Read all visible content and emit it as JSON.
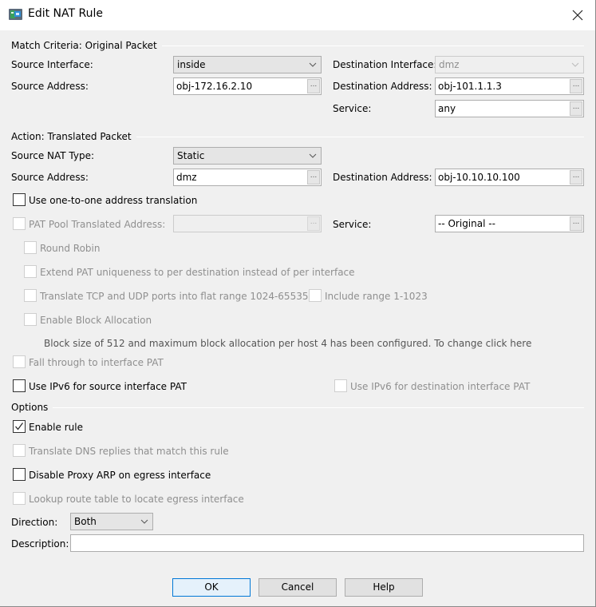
{
  "window": {
    "title": "Edit NAT Rule",
    "icon": "asdm-app-icon",
    "close_icon": "close-icon"
  },
  "match_criteria": {
    "section_title": "Match Criteria: Original Packet",
    "source_interface": {
      "label": "Source Interface:",
      "value": "inside"
    },
    "destination_interface": {
      "label": "Destination Interface:",
      "value": "dmz",
      "disabled": true
    },
    "source_address": {
      "label": "Source Address:",
      "value": "obj-172.16.2.10"
    },
    "destination_address": {
      "label": "Destination Address:",
      "value": "obj-101.1.1.3"
    },
    "service": {
      "label": "Service:",
      "value": "any"
    }
  },
  "action": {
    "section_title": "Action: Translated Packet",
    "source_nat_type": {
      "label": "Source NAT Type:",
      "value": "Static"
    },
    "source_address": {
      "label": "Source Address:",
      "value": "dmz"
    },
    "destination_address": {
      "label": "Destination Address:",
      "value": "obj-10.10.10.100"
    },
    "one_to_one": {
      "label": "Use one-to-one address translation",
      "checked": false,
      "disabled": false
    },
    "pat_pool": {
      "label": "PAT Pool Translated Address:",
      "value": "",
      "checked": false,
      "disabled": true
    },
    "service": {
      "label": "Service:",
      "value": "-- Original --"
    },
    "round_robin": {
      "label": "Round Robin",
      "checked": false,
      "disabled": true
    },
    "extend_pat": {
      "label": "Extend PAT uniqueness to per destination instead of per interface",
      "checked": false,
      "disabled": true
    },
    "flat_range": {
      "label": "Translate TCP and UDP ports into flat range 1024-65535",
      "checked": false,
      "disabled": true
    },
    "include_range": {
      "label": "Include range 1-1023",
      "checked": false,
      "disabled": true
    },
    "block_allocation": {
      "label": "Enable Block Allocation",
      "checked": false,
      "disabled": true
    },
    "block_info": "Block size of 512 and maximum block allocation per host 4 has been configured. To change click here",
    "fall_through": {
      "label": "Fall through to interface PAT",
      "checked": false,
      "disabled": true
    },
    "ipv6_source": {
      "label": "Use IPv6 for source interface PAT",
      "checked": false,
      "disabled": false
    },
    "ipv6_destination": {
      "label": "Use IPv6 for destination interface PAT",
      "checked": false,
      "disabled": true
    }
  },
  "options": {
    "section_title": "Options",
    "enable_rule": {
      "label": "Enable rule",
      "checked": true,
      "disabled": false
    },
    "translate_dns": {
      "label": "Translate DNS replies that match this rule",
      "checked": false,
      "disabled": true
    },
    "disable_proxy_arp": {
      "label": "Disable Proxy ARP on egress interface",
      "checked": false,
      "disabled": false
    },
    "lookup_route": {
      "label": "Lookup route table to locate egress interface",
      "checked": false,
      "disabled": true
    },
    "direction": {
      "label": "Direction:",
      "value": "Both"
    },
    "description": {
      "label": "Description:",
      "value": ""
    }
  },
  "buttons": {
    "ok": "OK",
    "cancel": "Cancel",
    "help": "Help"
  },
  "browse_glyph": "...",
  "colors": {
    "dialog_bg": "#f0f0f0",
    "default_button_border": "#0078d7",
    "default_button_bg": "#e5f1fb",
    "disabled_text": "#8f8f8f"
  }
}
